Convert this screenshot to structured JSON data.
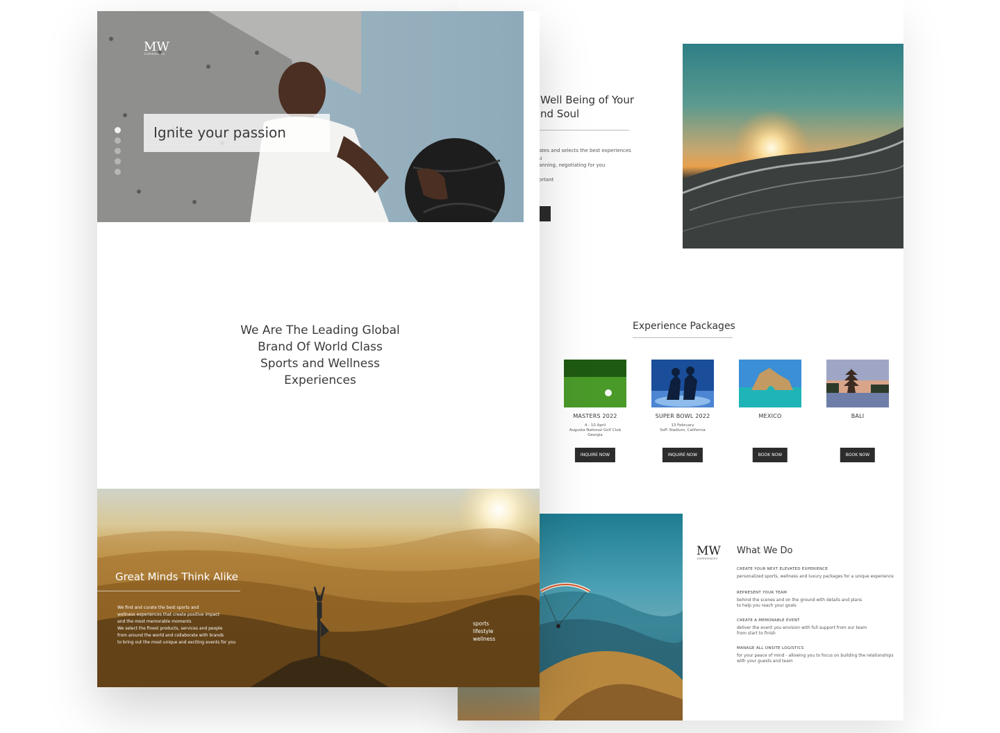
{
  "back_page": {
    "wellbeing": {
      "title_line1": "Well Being of Your",
      "title_line2": "nd Soul",
      "text_line1": "ates and selects the best experiences",
      "text_line2": "u",
      "text_line3": "anning, negotiating for you",
      "text_line4": "ortant"
    },
    "packages": {
      "title": "Experience Packages",
      "items": [
        {
          "title": "MASTERS 2022",
          "line1": "4 - 10 April",
          "line2": "Augusta National Golf Club",
          "line3": "Georgia",
          "button": "INQUIRE NOW"
        },
        {
          "title": "SUPER BOWL 2022",
          "line1": "13 February",
          "line2": "SoFi Stadium, California",
          "line3": "",
          "button": "INQUIRE NOW"
        },
        {
          "title": "MEXICO",
          "line1": "",
          "line2": "",
          "line3": "",
          "button": "BOOK NOW"
        },
        {
          "title": "BALI",
          "line1": "",
          "line2": "",
          "line3": "",
          "button": "BOOK NOW"
        }
      ]
    },
    "what_we_do": {
      "logo": "MW",
      "logo_sub": "EXPERIENCES",
      "title": "What We Do",
      "items": [
        {
          "title": "CREATE YOUR NEXT ELEVATED EXPERIENCE",
          "text_line1": "personalized sports, wellness and luxury packages for a unique experience",
          "text_line2": ""
        },
        {
          "title": "REPRESENT YOUR TEAM",
          "text_line1": "behind the scenes and on the ground with details and plans",
          "text_line2": "to help you reach your goals"
        },
        {
          "title": "CREATE A MEMORABLE EVENT",
          "text_line1": "deliver the event you envision with full support from our team",
          "text_line2": "from start to finish"
        },
        {
          "title": "MANAGE ALL ONSITE LOGISTICS",
          "text_line1": "for your peace of mind - allowing you to focus on building the relationships",
          "text_line2": "with your guests and team"
        }
      ]
    }
  },
  "front_page": {
    "logo": "MW",
    "logo_sub": "EXPERIENCES",
    "hero": {
      "caption": "Ignite your passion",
      "slide_count": 5,
      "active_slide": 1
    },
    "tagline": {
      "line1": "We Are The Leading Global",
      "line2": "Brand Of World Class",
      "line3": "Sports and Wellness",
      "line4": "Experiences"
    },
    "mountain": {
      "title": "Great Minds Think Alike",
      "text_line1": "We find and curate the best sports and",
      "text_line2": "wellness experiences that create positive impact",
      "text_line3": "and the most memorable moments",
      "text_line4": "We select the finest products, services and people",
      "text_line5": "from around the world and collaborate with brands",
      "text_line6": "to bring out the most unique and exciting events for you",
      "tags": [
        "sports",
        "lifestyle",
        "wellness"
      ]
    }
  },
  "colors": {
    "button_bg": "#2c2c2c",
    "text_dark": "#333333",
    "rule": "#bbbbbb"
  }
}
